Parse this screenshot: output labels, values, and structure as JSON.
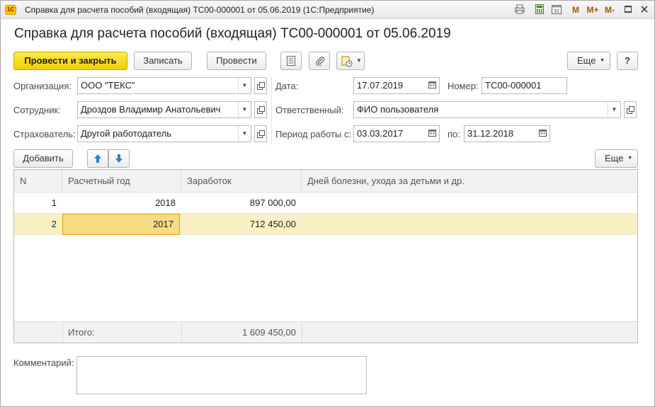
{
  "window": {
    "title": "Справка для расчета пособий (входящая) ТС00-000001 от 05.06.2019  (1С:Предприятие)",
    "logo": "1С",
    "titlebar_icons": [
      "print-icon",
      "calculator-icon",
      "calendar-icon"
    ],
    "m_labels": [
      "M",
      "M+",
      "M-"
    ],
    "controls": [
      "minimize-icon",
      "maximize-icon",
      "close-icon"
    ]
  },
  "header": {
    "title": "Справка для расчета пособий (входящая) ТС00-000001 от 05.06.2019"
  },
  "toolbar": {
    "post_close": "Провести и закрыть",
    "save": "Записать",
    "post": "Провести",
    "more": "Еще",
    "help": "?"
  },
  "form": {
    "organization": {
      "label": "Организация:",
      "value": "ООО \"ТЕКС\""
    },
    "employee": {
      "label": "Сотрудник:",
      "value": "Дроздов Владимир Анатольевич"
    },
    "insurer": {
      "label": "Страхователь:",
      "value": "Другой работодатель"
    },
    "date": {
      "label": "Дата:",
      "value": "17.07.2019"
    },
    "number": {
      "label": "Номер:",
      "value": "ТС00-000001"
    },
    "responsible": {
      "label": "Ответственный:",
      "value": "ФИО пользователя"
    },
    "period_from": {
      "label": "Период работы с:",
      "value": "03.03.2017"
    },
    "period_to": {
      "label": "по:",
      "value": "31.12.2018"
    }
  },
  "table_toolbar": {
    "add": "Добавить",
    "more": "Еще"
  },
  "table": {
    "columns": [
      "N",
      "Расчетный год",
      "Заработок",
      "Дней болезни, ухода за детьми и др."
    ],
    "rows": [
      {
        "n": "1",
        "year": "2018",
        "earnings": "897 000,00",
        "days": ""
      },
      {
        "n": "2",
        "year": "2017",
        "earnings": "712 450,00",
        "days": ""
      }
    ],
    "footer": {
      "label": "Итого:",
      "total": "1 609 450,00"
    }
  },
  "comment": {
    "label": "Комментарий:",
    "value": ""
  },
  "colors": {
    "primary_button": "#f3cd00",
    "selected_row": "#fbefc4",
    "active_cell": "#f7dc85",
    "arrow_blue": "#2f7fd1"
  }
}
